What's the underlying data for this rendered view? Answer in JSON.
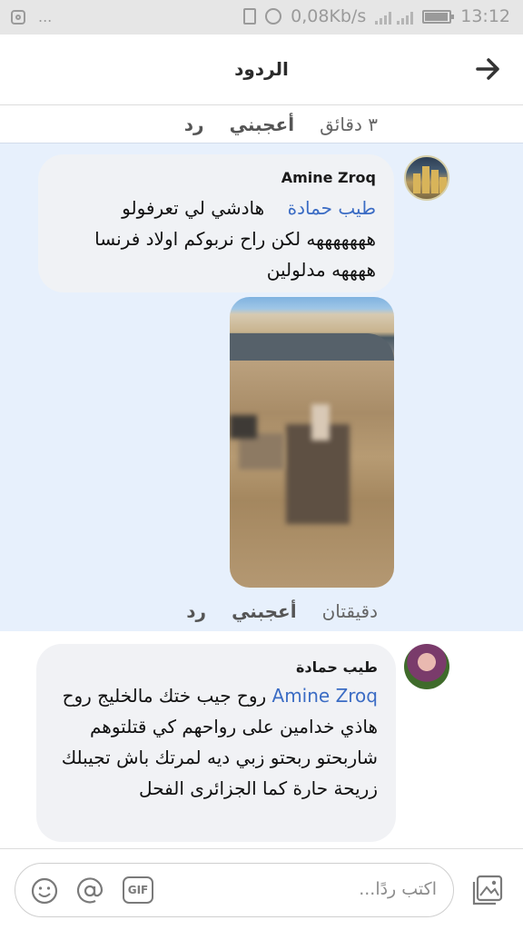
{
  "status_bar": {
    "left_dots": "...",
    "network_speed": "0,08Kb/s",
    "network_type": "4G 4G",
    "time": "13:12",
    "icons": [
      "instagram-icon",
      "vibrate-icon",
      "alarm-icon",
      "signal-icon",
      "battery-icon"
    ]
  },
  "header": {
    "title": "الردود",
    "back_icon": "arrow-right-icon"
  },
  "prev_comment_actions": {
    "time": "٣ دقائق",
    "like": "أعجبني",
    "reply": "رد"
  },
  "comment_1": {
    "author": "Amine Zroq",
    "mention": "طيب حمادة",
    "text": "هادشي لي تعرفولو هههههههه لكن راح نربوكم اولاد فرنسا ههههه مدلولين",
    "image": "blurred-photo",
    "actions": {
      "time": "دقيقتان",
      "like": "أعجبني",
      "reply": "رد"
    }
  },
  "comment_2": {
    "author": "طيب حمادة",
    "mention": "Amine Zroq",
    "text": "روح جيب ختك مالخليج روح هاذي خدامين على رواحهم كي قتلتوهم شاربحتو ربحتو زبي ديه لمرتك باش تجيبلك زريحة حارة كما الجزائرى الفحل"
  },
  "composer": {
    "placeholder": "اكتب ردًا...",
    "icons": [
      "photo-icon",
      "gif-icon",
      "at-icon",
      "emoji-icon"
    ],
    "gif_label": "GIF"
  },
  "colors": {
    "highlight": "#e7f0fc",
    "bubble": "#f1f2f5",
    "mention": "#3b6cc4"
  }
}
